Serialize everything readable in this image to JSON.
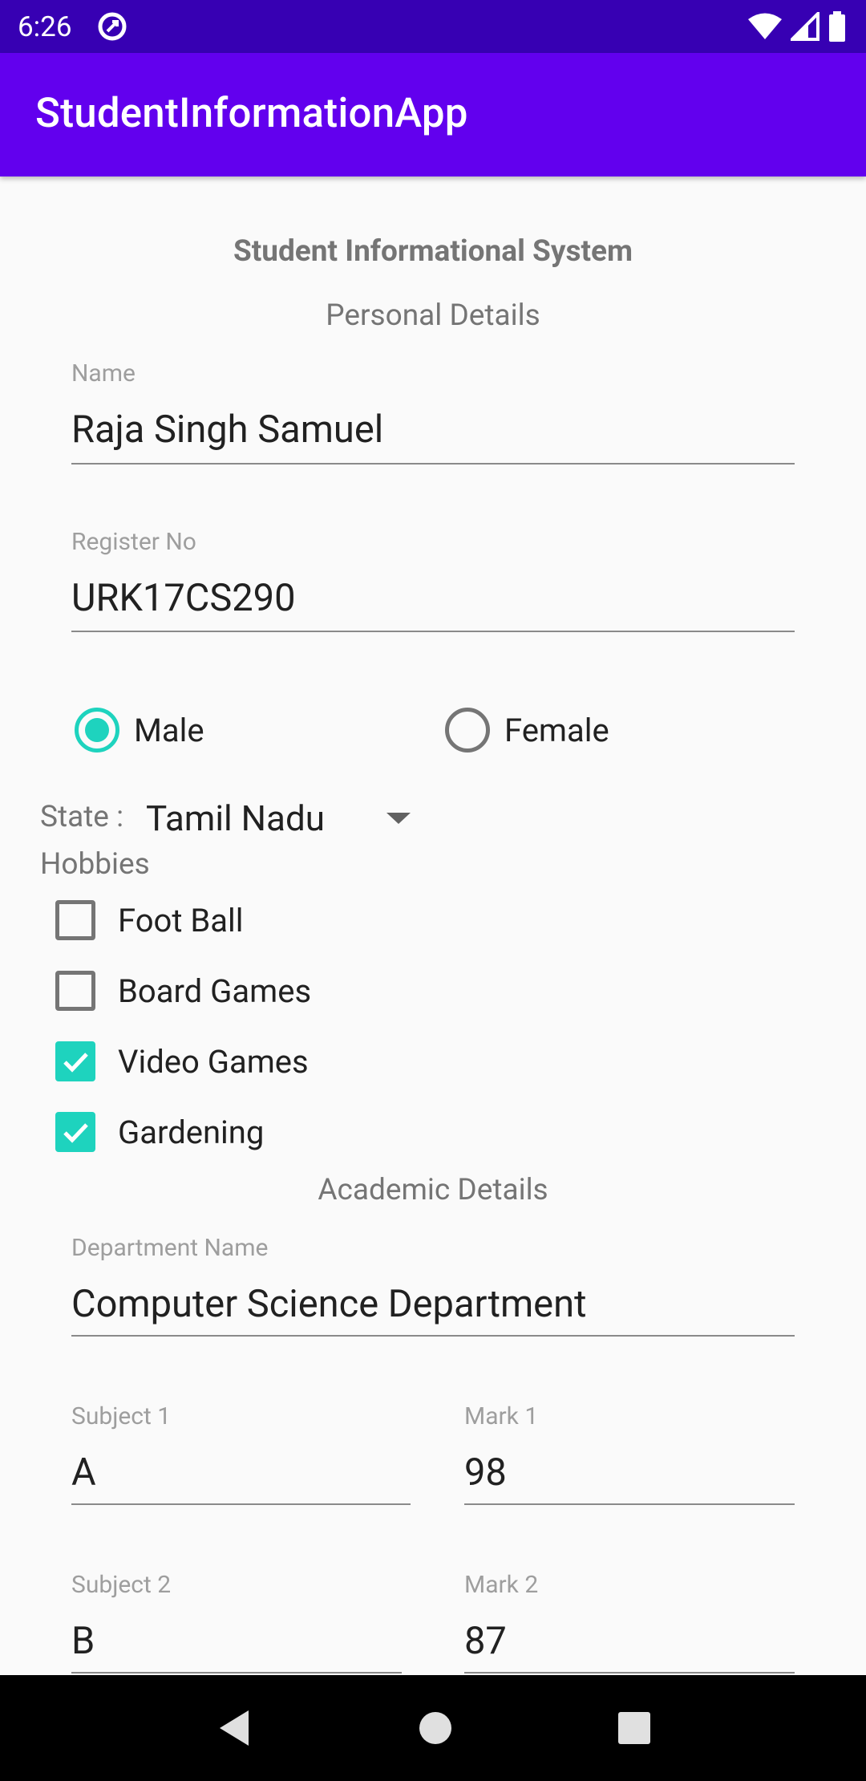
{
  "status_bar": {
    "time": "6:26"
  },
  "app_bar": {
    "title": "StudentInformationApp"
  },
  "form": {
    "title": "Student Informational System",
    "personal_section": "Personal Details",
    "name": {
      "label": "Name",
      "value": "Raja Singh Samuel"
    },
    "register_no": {
      "label": "Register No",
      "value": "URK17CS290"
    },
    "gender": {
      "options": [
        {
          "label": "Male",
          "selected": true
        },
        {
          "label": "Female",
          "selected": false
        }
      ]
    },
    "state": {
      "label": "State :",
      "value": "Tamil Nadu"
    },
    "hobbies": {
      "label": "Hobbies",
      "items": [
        {
          "label": "Foot Ball",
          "checked": false
        },
        {
          "label": "Board Games",
          "checked": false
        },
        {
          "label": "Video Games",
          "checked": true
        },
        {
          "label": "Gardening",
          "checked": true
        }
      ]
    },
    "academic_section": "Academic Details",
    "department": {
      "label": "Department Name",
      "value": "Computer Science Department"
    },
    "subjects": [
      {
        "subject_label": "Subject 1",
        "subject_value": "A",
        "mark_label": "Mark 1",
        "mark_value": "98"
      },
      {
        "subject_label": "Subject 2",
        "subject_value": "B",
        "mark_label": "Mark 2",
        "mark_value": "87"
      }
    ]
  },
  "colors": {
    "status_bar": "#3700B3",
    "app_bar": "#6200EE",
    "accent": "#1ED3BE"
  }
}
